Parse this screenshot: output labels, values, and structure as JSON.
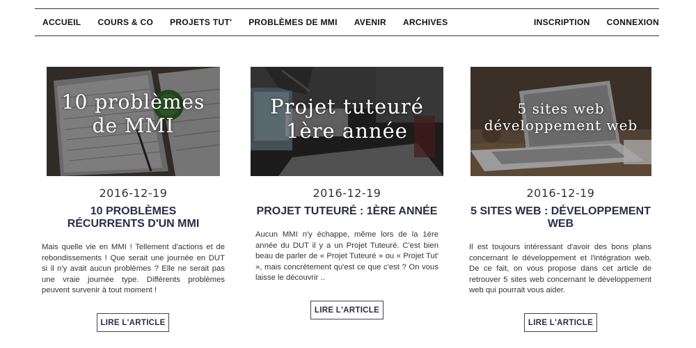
{
  "nav": {
    "left": [
      "ACCUEIL",
      "COURS & CO",
      "PROJETS TUT'",
      "PROBLÈMES DE MMI",
      "AVENIR",
      "ARCHIVES"
    ],
    "right": [
      "INSCRIPTION",
      "CONNEXION"
    ]
  },
  "articles": [
    {
      "image_lines": [
        "10 problèmes",
        "de MMI"
      ],
      "date": "2016-12-19",
      "title": "10 PROBLÈMES RÉCURRENTS D'UN MMI",
      "excerpt": "Mais quelle vie en MMI ! Tellement d'actions et de rebondissements ! Que serait une journée en DUT si il n'y avait aucun problèmes ? Elle ne serait pas une vraie journée type. Différents problèmes peuvent survenir à tout moment !",
      "button": "LIRE L'ARTICLE"
    },
    {
      "image_lines": [
        "Projet tuteuré",
        "1ère année"
      ],
      "date": "2016-12-19",
      "title": "PROJET TUTEURÉ : 1ÈRE ANNÉE",
      "excerpt": "Aucun MMI n'y échappe, même lors de la 1ère année du DUT il y a un Projet Tuteuré. C'est bien beau de parler de « Projet Tuteuré » ou « Projet Tut' », mais concrètement qu'est ce que c'est ? On vous laisse le découvrir ..",
      "button": "LIRE L'ARTICLE"
    },
    {
      "image_lines": [
        "5 sites web",
        "développement web"
      ],
      "date": "2016-12-19",
      "title": "5 SITES WEB : DÉVELOPPEMENT WEB",
      "excerpt": "Il est toujours intéressant d'avoir des bons plans concernant le développement et l'intégration web. De ce fait, on vous propose dans cet article de retrouver 5 sites web concernant le développement web qui pourrait vous aider.",
      "button": "LIRE L'ARTICLE"
    }
  ]
}
